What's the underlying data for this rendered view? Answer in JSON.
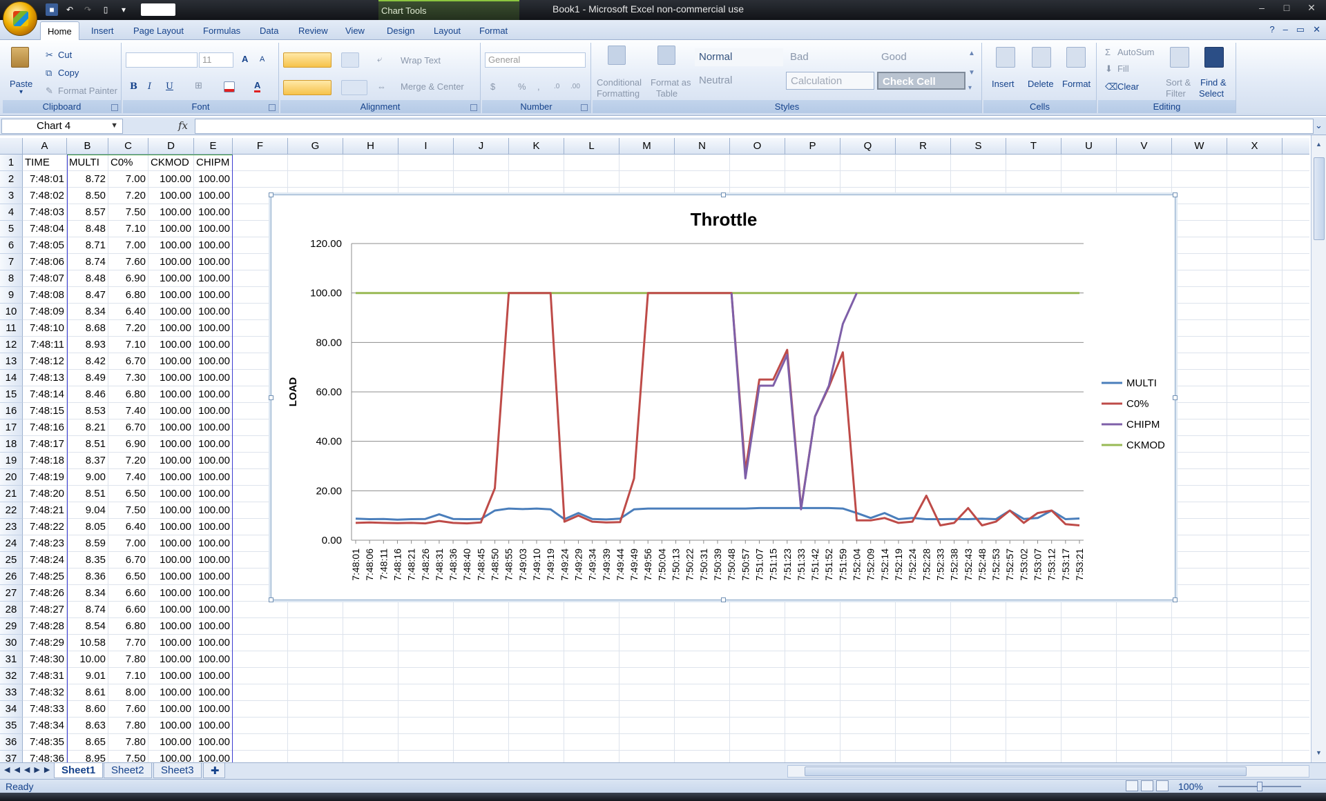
{
  "window": {
    "title": "Book1 - Microsoft Excel non-commercial use",
    "context_tab_group": "Chart Tools",
    "controls": [
      "–",
      "□",
      "✕"
    ]
  },
  "ribbon": {
    "tabs": [
      "Home",
      "Insert",
      "Page Layout",
      "Formulas",
      "Data",
      "Review",
      "View",
      "Design",
      "Layout",
      "Format"
    ],
    "active_tab": "Home",
    "clipboard": {
      "label": "Clipboard",
      "paste": "Paste",
      "cut": "Cut",
      "copy": "Copy",
      "format_painter": "Format Painter"
    },
    "font": {
      "label": "Font",
      "size": "11",
      "bold": "B",
      "italic": "I",
      "underline": "U",
      "font_color": "A",
      "grow": "A",
      "shrink": "A"
    },
    "alignment": {
      "label": "Alignment",
      "wrap_text": "Wrap Text",
      "merge_center": "Merge & Center"
    },
    "number": {
      "label": "Number",
      "format": "General",
      "currency": "$",
      "percent": "%",
      "comma": ",",
      "inc_dec": ".0",
      "dec_dec": ".00"
    },
    "styles": {
      "label": "Styles",
      "conditional_formatting": [
        "Conditional",
        "Formatting"
      ],
      "format_as_table": [
        "Format as",
        "Table"
      ],
      "cells": [
        "Normal",
        "Bad",
        "Good",
        "Neutral",
        "Calculation",
        "Check Cell"
      ]
    },
    "cells": {
      "label": "Cells",
      "insert": "Insert",
      "delete": "Delete",
      "format": "Format"
    },
    "editing": {
      "label": "Editing",
      "autosum": "AutoSum",
      "fill": "Fill",
      "clear": "Clear",
      "sort_filter": [
        "Sort &",
        "Filter"
      ],
      "find_select": [
        "Find &",
        "Select"
      ]
    }
  },
  "formula_bar": {
    "name_box": "Chart 4",
    "fx": "fx",
    "formula": ""
  },
  "columns": [
    "A",
    "B",
    "C",
    "D",
    "E",
    "F",
    "G",
    "H",
    "I",
    "J",
    "K",
    "L",
    "M",
    "N",
    "O",
    "P",
    "Q",
    "R",
    "S",
    "T",
    "U",
    "V",
    "W",
    "X"
  ],
  "rows": [
    "1",
    "2",
    "3",
    "4",
    "5",
    "6",
    "7",
    "8",
    "9",
    "10",
    "11",
    "12",
    "13",
    "14",
    "15",
    "16",
    "17",
    "18",
    "19",
    "20",
    "21",
    "22",
    "23",
    "24",
    "25",
    "26",
    "27",
    "28",
    "29",
    "30",
    "31",
    "32",
    "33",
    "34",
    "35",
    "36",
    "37"
  ],
  "sheet": {
    "headers": [
      "TIME",
      "MULTI",
      "C0%",
      "CKMOD",
      "CHIPM"
    ],
    "data": [
      [
        "7:48:01",
        "8.72",
        "7.00",
        "100.00",
        "100.00"
      ],
      [
        "7:48:02",
        "8.50",
        "7.20",
        "100.00",
        "100.00"
      ],
      [
        "7:48:03",
        "8.57",
        "7.50",
        "100.00",
        "100.00"
      ],
      [
        "7:48:04",
        "8.48",
        "7.10",
        "100.00",
        "100.00"
      ],
      [
        "7:48:05",
        "8.71",
        "7.00",
        "100.00",
        "100.00"
      ],
      [
        "7:48:06",
        "8.74",
        "7.60",
        "100.00",
        "100.00"
      ],
      [
        "7:48:07",
        "8.48",
        "6.90",
        "100.00",
        "100.00"
      ],
      [
        "7:48:08",
        "8.47",
        "6.80",
        "100.00",
        "100.00"
      ],
      [
        "7:48:09",
        "8.34",
        "6.40",
        "100.00",
        "100.00"
      ],
      [
        "7:48:10",
        "8.68",
        "7.20",
        "100.00",
        "100.00"
      ],
      [
        "7:48:11",
        "8.93",
        "7.10",
        "100.00",
        "100.00"
      ],
      [
        "7:48:12",
        "8.42",
        "6.70",
        "100.00",
        "100.00"
      ],
      [
        "7:48:13",
        "8.49",
        "7.30",
        "100.00",
        "100.00"
      ],
      [
        "7:48:14",
        "8.46",
        "6.80",
        "100.00",
        "100.00"
      ],
      [
        "7:48:15",
        "8.53",
        "7.40",
        "100.00",
        "100.00"
      ],
      [
        "7:48:16",
        "8.21",
        "6.70",
        "100.00",
        "100.00"
      ],
      [
        "7:48:17",
        "8.51",
        "6.90",
        "100.00",
        "100.00"
      ],
      [
        "7:48:18",
        "8.37",
        "7.20",
        "100.00",
        "100.00"
      ],
      [
        "7:48:19",
        "9.00",
        "7.40",
        "100.00",
        "100.00"
      ],
      [
        "7:48:20",
        "8.51",
        "6.50",
        "100.00",
        "100.00"
      ],
      [
        "7:48:21",
        "9.04",
        "7.50",
        "100.00",
        "100.00"
      ],
      [
        "7:48:22",
        "8.05",
        "6.40",
        "100.00",
        "100.00"
      ],
      [
        "7:48:23",
        "8.59",
        "7.00",
        "100.00",
        "100.00"
      ],
      [
        "7:48:24",
        "8.35",
        "6.70",
        "100.00",
        "100.00"
      ],
      [
        "7:48:25",
        "8.36",
        "6.50",
        "100.00",
        "100.00"
      ],
      [
        "7:48:26",
        "8.34",
        "6.60",
        "100.00",
        "100.00"
      ],
      [
        "7:48:27",
        "8.74",
        "6.60",
        "100.00",
        "100.00"
      ],
      [
        "7:48:28",
        "8.54",
        "6.80",
        "100.00",
        "100.00"
      ],
      [
        "7:48:29",
        "10.58",
        "7.70",
        "100.00",
        "100.00"
      ],
      [
        "7:48:30",
        "10.00",
        "7.80",
        "100.00",
        "100.00"
      ],
      [
        "7:48:31",
        "9.01",
        "7.10",
        "100.00",
        "100.00"
      ],
      [
        "7:48:32",
        "8.61",
        "8.00",
        "100.00",
        "100.00"
      ],
      [
        "7:48:33",
        "8.60",
        "7.60",
        "100.00",
        "100.00"
      ],
      [
        "7:48:34",
        "8.63",
        "7.80",
        "100.00",
        "100.00"
      ],
      [
        "7:48:35",
        "8.65",
        "7.80",
        "100.00",
        "100.00"
      ],
      [
        "7:48:36",
        "8.95",
        "7.50",
        "100.00",
        "100.00"
      ]
    ]
  },
  "sheet_tabs": [
    "Sheet1",
    "Sheet2",
    "Sheet3"
  ],
  "active_sheet": "Sheet1",
  "status": {
    "ready": "Ready",
    "zoom": "100%"
  },
  "colors": {
    "multi": "#4a7ebb",
    "c0": "#be4b48",
    "chipm": "#7e5fa8",
    "ckmod": "#98b954"
  },
  "chart_data": {
    "type": "line",
    "title": "Throttle",
    "xlabel": "",
    "ylabel": "LOAD",
    "ylim": [
      0,
      120
    ],
    "yticks": [
      "0.00",
      "20.00",
      "40.00",
      "60.00",
      "80.00",
      "100.00",
      "120.00"
    ],
    "grid": true,
    "legend": "right",
    "x_ticks": [
      "7:48:01",
      "7:48:06",
      "7:48:11",
      "7:48:16",
      "7:48:21",
      "7:48:26",
      "7:48:31",
      "7:48:36",
      "7:48:40",
      "7:48:45",
      "7:48:50",
      "7:48:55",
      "7:49:03",
      "7:49:10",
      "7:49:19",
      "7:49:24",
      "7:49:29",
      "7:49:34",
      "7:49:39",
      "7:49:44",
      "7:49:49",
      "7:49:56",
      "7:50:04",
      "7:50:13",
      "7:50:22",
      "7:50:31",
      "7:50:39",
      "7:50:48",
      "7:50:57",
      "7:51:07",
      "7:51:15",
      "7:51:23",
      "7:51:33",
      "7:51:42",
      "7:51:52",
      "7:51:59",
      "7:52:04",
      "7:52:09",
      "7:52:14",
      "7:52:19",
      "7:52:24",
      "7:52:28",
      "7:52:33",
      "7:52:38",
      "7:52:43",
      "7:52:48",
      "7:52:53",
      "7:52:57",
      "7:53:02",
      "7:53:07",
      "7:53:12",
      "7:53:17",
      "7:53:21"
    ],
    "series": [
      {
        "name": "MULTI",
        "color": "#4a7ebb",
        "values": [
          8.7,
          8.5,
          8.6,
          8.3,
          8.5,
          8.6,
          10.5,
          8.6,
          8.5,
          8.6,
          12.0,
          12.8,
          12.6,
          12.8,
          12.5,
          8.5,
          11.0,
          8.6,
          8.4,
          8.7,
          12.5,
          12.8,
          12.8,
          12.8,
          12.8,
          12.8,
          12.8,
          12.8,
          12.8,
          13.0,
          13.0,
          13.0,
          13.0,
          13.0,
          13.0,
          12.8,
          11.0,
          9.0,
          11.0,
          8.5,
          9.0,
          8.5,
          8.5,
          8.6,
          8.5,
          8.7,
          8.5,
          12.0,
          8.6,
          9.0,
          12.0,
          8.5,
          8.8
        ]
      },
      {
        "name": "C0%",
        "color": "#be4b48",
        "values": [
          7.0,
          7.2,
          7.0,
          6.9,
          7.0,
          6.8,
          7.8,
          7.0,
          6.8,
          7.2,
          21.0,
          100.0,
          100.0,
          100.0,
          100.0,
          7.5,
          10.0,
          7.5,
          7.2,
          7.3,
          25.0,
          100.0,
          100.0,
          100.0,
          100.0,
          100.0,
          100.0,
          100.0,
          28.0,
          65.0,
          65.0,
          77.0,
          13.0,
          50.0,
          62.0,
          76.0,
          8.0,
          8.0,
          9.0,
          7.0,
          7.5,
          18.0,
          6.0,
          7.0,
          13.0,
          6.0,
          7.5,
          12.0,
          7.0,
          11.0,
          12.0,
          6.5,
          6.0
        ]
      },
      {
        "name": "CHIPM",
        "color": "#7e5fa8",
        "values": [
          null,
          null,
          null,
          null,
          null,
          null,
          null,
          null,
          null,
          null,
          null,
          null,
          null,
          null,
          null,
          null,
          null,
          null,
          null,
          null,
          null,
          null,
          null,
          null,
          null,
          null,
          null,
          100.0,
          25.0,
          62.5,
          62.5,
          75.0,
          12.5,
          50.0,
          62.5,
          87.5,
          100.0,
          null,
          null,
          null,
          null,
          null,
          null,
          null,
          null,
          null,
          null,
          null,
          null,
          null,
          null,
          null,
          null
        ]
      },
      {
        "name": "CKMOD",
        "color": "#98b954",
        "values": [
          100,
          100,
          100,
          100,
          100,
          100,
          100,
          100,
          100,
          100,
          100,
          100,
          100,
          100,
          100,
          100,
          100,
          100,
          100,
          100,
          100,
          100,
          100,
          100,
          100,
          100,
          100,
          100,
          100,
          100,
          100,
          100,
          100,
          100,
          100,
          100,
          100,
          100,
          100,
          100,
          100,
          100,
          100,
          100,
          100,
          100,
          100,
          100,
          100,
          100,
          100,
          100,
          100
        ]
      }
    ]
  }
}
